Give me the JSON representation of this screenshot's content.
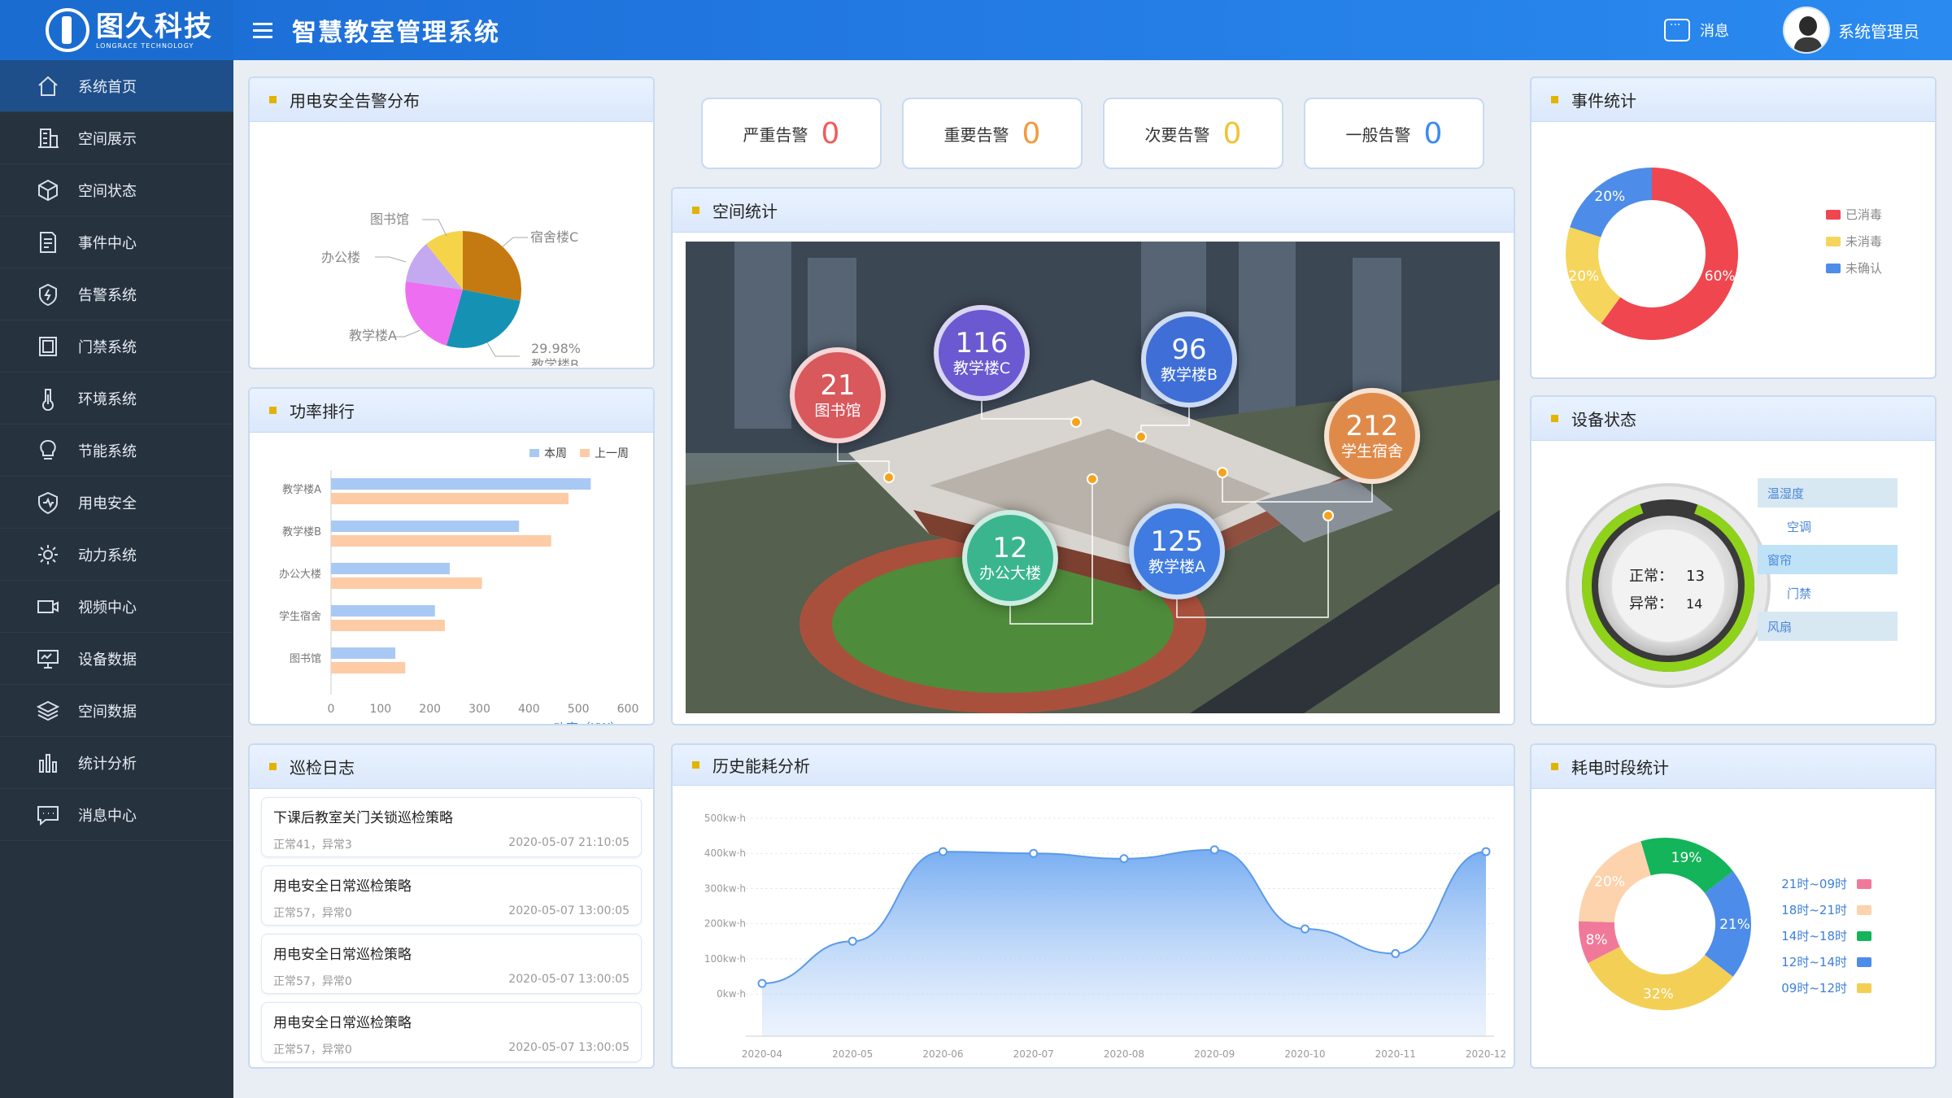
{
  "app": {
    "logo_cn": "图久科技",
    "logo_en": "LONGRACE TECHNOLOGY",
    "title": "智慧教室管理系统",
    "message_label": "消息",
    "user_name": "系统管理员"
  },
  "sidebar": {
    "items": [
      {
        "label": "系统首页",
        "icon": "home-icon"
      },
      {
        "label": "空间展示",
        "icon": "building-icon"
      },
      {
        "label": "空间状态",
        "icon": "cube-icon"
      },
      {
        "label": "事件中心",
        "icon": "document-icon"
      },
      {
        "label": "告警系统",
        "icon": "alarm-icon"
      },
      {
        "label": "门禁系统",
        "icon": "door-icon"
      },
      {
        "label": "环境系统",
        "icon": "thermometer-icon"
      },
      {
        "label": "节能系统",
        "icon": "bulb-icon"
      },
      {
        "label": "用电安全",
        "icon": "shield-icon"
      },
      {
        "label": "动力系统",
        "icon": "gear-icon"
      },
      {
        "label": "视频中心",
        "icon": "video-icon"
      },
      {
        "label": "设备数据",
        "icon": "monitor-icon"
      },
      {
        "label": "空间数据",
        "icon": "layers-icon"
      },
      {
        "label": "统计分析",
        "icon": "bar-chart-icon"
      },
      {
        "label": "消息中心",
        "icon": "chat-icon"
      }
    ]
  },
  "alarms": [
    {
      "label": "严重告警",
      "count": "0",
      "color": "#f25b5b"
    },
    {
      "label": "重要告警",
      "count": "0",
      "color": "#f39a3d"
    },
    {
      "label": "次要告警",
      "count": "0",
      "color": "#f2c233"
    },
    {
      "label": "一般告警",
      "count": "0",
      "color": "#3d8bef"
    }
  ],
  "panels": {
    "safety_title": "用电安全告警分布",
    "power_title": "功率排行",
    "log_title": "巡检日志",
    "space_title": "空间统计",
    "history_title": "历史能耗分析",
    "event_title": "事件统计",
    "device_title": "设备状态",
    "period_title": "耗电时段统计"
  },
  "safety_pie": {
    "slice_labels": [
      "宿舍楼C",
      "图书馆",
      "办公楼",
      "教学楼A",
      "教学楼B"
    ],
    "b_percent": "29.98%",
    "colors": [
      "#c47a10",
      "#f5d44a",
      "#c4a9f0",
      "#ee6ef2",
      "#1592b3"
    ]
  },
  "chart_data": [
    {
      "type": "bar",
      "title": "功率排行",
      "categories": [
        "教学楼A",
        "教学楼B",
        "办公大楼",
        "学生宿舍",
        "图书馆"
      ],
      "series": [
        {
          "name": "本周",
          "values": [
            525,
            380,
            240,
            210,
            130
          ],
          "color": "#a9c9f5"
        },
        {
          "name": "上一周",
          "values": [
            480,
            445,
            305,
            230,
            150
          ],
          "color": "#fdcba6"
        }
      ],
      "xlabel": "功率（KW）",
      "xlim": [
        0,
        600
      ],
      "xticks": [
        "0",
        "100",
        "200",
        "300",
        "400",
        "500",
        "600"
      ]
    },
    {
      "type": "area",
      "title": "历史能耗分析",
      "x": [
        "2020-04",
        "2020-05",
        "2020-06",
        "2020-07",
        "2020-08",
        "2020-09",
        "2020-10",
        "2020-11",
        "2020-12"
      ],
      "y": [
        30,
        150,
        405,
        400,
        385,
        410,
        185,
        115,
        405
      ],
      "yticks": [
        "0kw·h",
        "100kw·h",
        "200kw·h",
        "300kw·h",
        "400kw·h",
        "500kw·h"
      ],
      "ylim": [
        -120,
        500
      ]
    },
    {
      "type": "pie",
      "title": "事件统计",
      "labels": [
        "已消毒",
        "未消毒",
        "未确认"
      ],
      "values": [
        60,
        20,
        20
      ],
      "display": [
        "60%",
        "20%",
        "20%"
      ],
      "colors": [
        "#f0464f",
        "#f5d55c",
        "#4d8ce8"
      ]
    },
    {
      "type": "pie",
      "title": "耗电时段统计",
      "labels": [
        "21时~09时",
        "18时~21时",
        "14时~18时",
        "12时~14时",
        "09时~12时"
      ],
      "values": [
        8,
        20,
        19,
        21,
        32
      ],
      "display": [
        "8%",
        "20%",
        "19%",
        "21%",
        "32%"
      ],
      "colors": [
        "#f0799a",
        "#fdd3ad",
        "#14b45a",
        "#4d8ce8",
        "#f3cf55"
      ]
    }
  ],
  "space_stats": [
    {
      "num": "21",
      "name": "图书馆",
      "color": "#d9585c"
    },
    {
      "num": "116",
      "name": "教学楼C",
      "color": "#6a59d0"
    },
    {
      "num": "96",
      "name": "教学楼B",
      "color": "#3f6fd6"
    },
    {
      "num": "212",
      "name": "学生宿舍",
      "color": "#e08a4a"
    },
    {
      "num": "12",
      "name": "办公大楼",
      "color": "#3bb58d"
    },
    {
      "num": "125",
      "name": "教学楼A",
      "color": "#3f7be0"
    }
  ],
  "logs": [
    {
      "title": "下课后教室关门关锁巡检策略",
      "status": "正常41，异常3",
      "time": "2020-05-07 21:10:05"
    },
    {
      "title": "用电安全日常巡检策略",
      "status": "正常57，异常0",
      "time": "2020-05-07 13:00:05"
    },
    {
      "title": "用电安全日常巡检策略",
      "status": "正常57，异常0",
      "time": "2020-05-07 13:00:05"
    },
    {
      "title": "用电安全日常巡检策略",
      "status": "正常57，异常0",
      "time": "2020-05-07 13:00:05"
    }
  ],
  "device_status": {
    "normal_label": "正常：",
    "normal_value": "13",
    "abnormal_label": "异常：",
    "abnormal_value": "14",
    "devices": [
      "温湿度",
      "空调",
      "窗帘",
      "门禁",
      "风扇"
    ]
  }
}
